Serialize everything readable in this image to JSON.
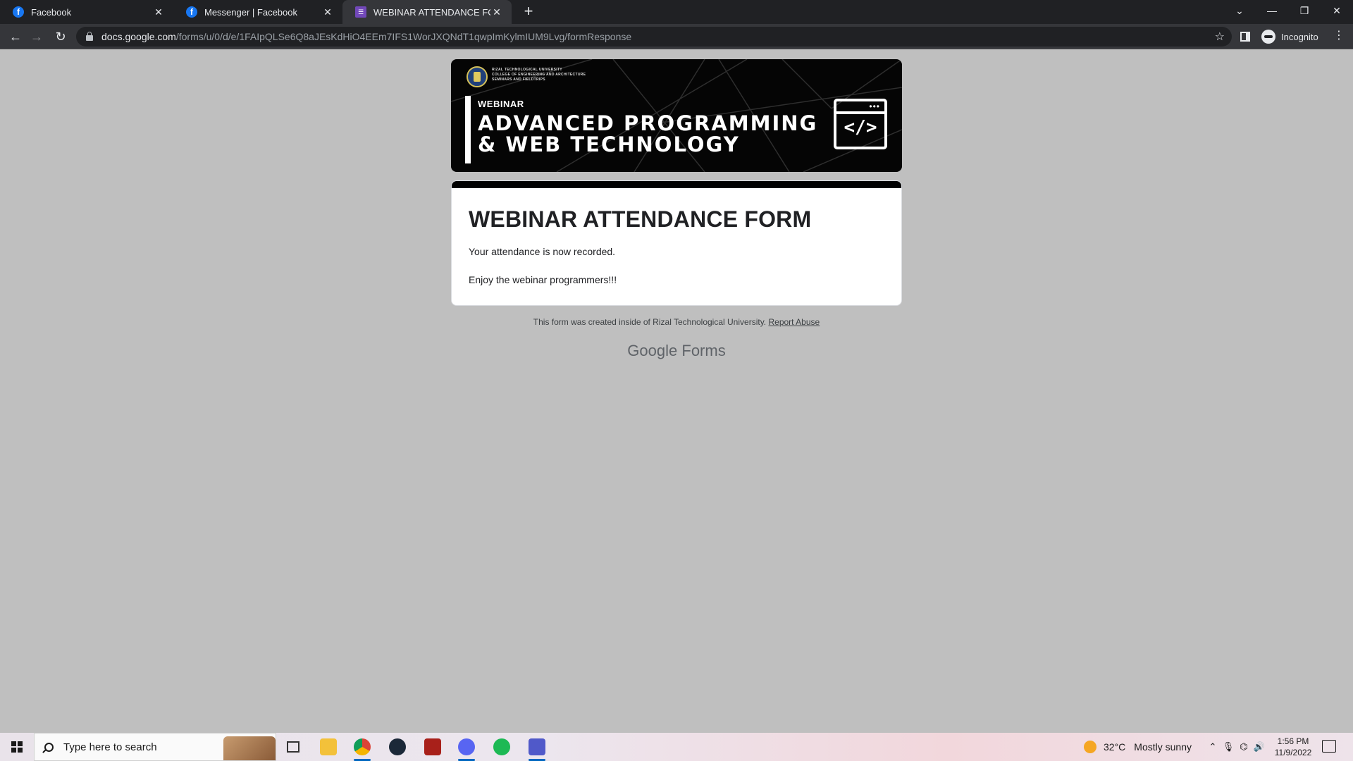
{
  "browser": {
    "tabs": [
      {
        "title": "Facebook",
        "favicon": "facebook-icon"
      },
      {
        "title": "Messenger | Facebook",
        "favicon": "facebook-icon"
      },
      {
        "title": "WEBINAR ATTENDANCE FORM",
        "favicon": "google-forms-icon"
      }
    ],
    "url_host": "docs.google.com",
    "url_path": "/forms/u/0/d/e/1FAIpQLSe6Q8aJEsKdHiO4EEm7IFS1WorJXQNdT1qwpImKylmIUM9Lvg/formResponse",
    "profile_label": "Incognito"
  },
  "banner": {
    "university_lines": [
      "RIZAL TECHNOLOGICAL UNIVERSITY",
      "COLLEGE OF ENGINEERING AND ARCHITECTURE",
      "SEMINARS AND FIELDTRIPS"
    ],
    "tag": "WEBINAR",
    "title_line1": "ADVANCED PROGRAMMING",
    "title_line2": "& WEB TECHNOLOGY",
    "code_glyph": "</>",
    "dots": "•••"
  },
  "form": {
    "title": "WEBINAR ATTENDANCE FORM",
    "message1": "Your attendance is now recorded.",
    "message2": "Enjoy the webinar programmers!!!"
  },
  "footer": {
    "note": "This form was created inside of Rizal Technological University.",
    "report_link": "Report Abuse",
    "brand_google": "Google",
    "brand_forms": "Forms"
  },
  "taskbar": {
    "search_placeholder": "Type here to search",
    "apps": [
      "task-view-icon",
      "file-explorer-icon",
      "chrome-icon",
      "steam-icon",
      "dota-icon",
      "discord-icon",
      "spotify-icon",
      "teams-icon"
    ],
    "weather_temp": "32°C",
    "weather_condition": "Mostly sunny",
    "time": "1:56 PM",
    "date": "11/9/2022"
  },
  "colors": {
    "page_background": "#bfbfbf",
    "form_accent": "#000000",
    "chrome_dark": "#202124"
  }
}
